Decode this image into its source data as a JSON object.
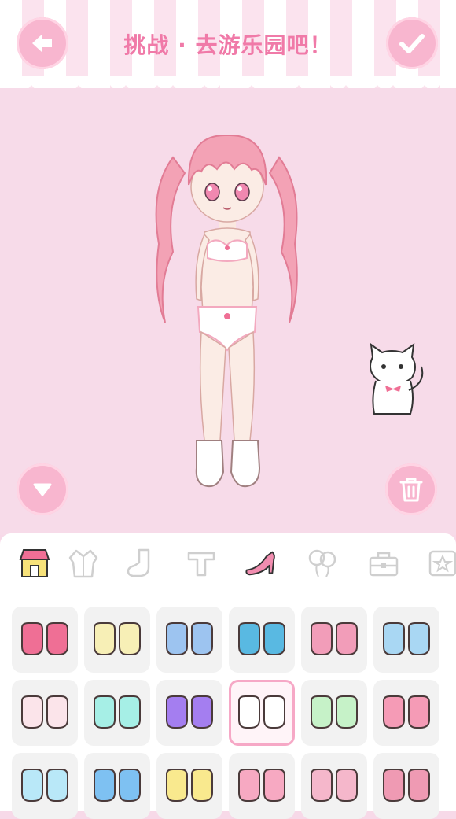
{
  "header": {
    "title": "挑战 · 去游乐园吧！",
    "back_icon": "arrow-left-icon",
    "confirm_icon": "checkmark-icon"
  },
  "stage": {
    "collapse_icon": "triangle-down-icon",
    "delete_icon": "trash-icon",
    "character": "pink-haired-girl-in-underwear",
    "pet": "white-cat-with-pink-bow"
  },
  "colors": {
    "accent": "#f07aa8",
    "button": "#f8b6cf",
    "background": "#f7d9e8",
    "tile": "#f2f2f2",
    "selected_border": "#f6a8c6"
  },
  "categories": [
    {
      "name": "shop",
      "icon": "shop-icon",
      "active": false
    },
    {
      "name": "coat",
      "icon": "coat-icon",
      "active": false
    },
    {
      "name": "socks",
      "icon": "sock-icon",
      "active": false
    },
    {
      "name": "tops",
      "icon": "tshirt-icon",
      "active": false
    },
    {
      "name": "shoes",
      "icon": "high-heel-icon",
      "active": true
    },
    {
      "name": "accessories",
      "icon": "balloon-icon",
      "active": false
    },
    {
      "name": "bags",
      "icon": "bag-icon",
      "active": false
    },
    {
      "name": "favorites",
      "icon": "star-icon",
      "active": false
    }
  ],
  "items": [
    {
      "icon": "pink-mary-jane-shoes-icon",
      "color": "#ef6f95"
    },
    {
      "icon": "cream-strap-shoes-icon",
      "color": "#f7efb6"
    },
    {
      "icon": "blue-yellow-buckle-shoes-icon",
      "color": "#9dc4f0"
    },
    {
      "icon": "blue-sneakers-icon",
      "color": "#59b9e2"
    },
    {
      "icon": "pink-buckle-shoes-icon",
      "color": "#f29db9"
    },
    {
      "icon": "blue-sandals-icon",
      "color": "#a9d7f3"
    },
    {
      "icon": "bear-slippers-icon",
      "color": "#fbe4ea"
    },
    {
      "icon": "bunny-slippers-icon",
      "color": "#a6efe6"
    },
    {
      "icon": "purple-flats-icon",
      "color": "#a47ef0"
    },
    {
      "icon": "white-socks-icon",
      "color": "#ffffff",
      "selected": true
    },
    {
      "icon": "bunny-ear-shoes-icon",
      "color": "#c6f2c8"
    },
    {
      "icon": "pink-bow-shoes-icon",
      "color": "#f59bb6"
    },
    {
      "icon": "blue-ankle-boots-icon",
      "color": "#b9e8f8"
    },
    {
      "icon": "blue-bow-boots-icon",
      "color": "#7ec1f2"
    },
    {
      "icon": "yellow-bow-shoes-icon",
      "color": "#f9e98e"
    },
    {
      "icon": "pink-frill-boots-icon",
      "color": "#f7a9c2"
    },
    {
      "icon": "pink-bow-boots-icon",
      "color": "#f5b7cb"
    },
    {
      "icon": "pink-lace-boots-icon",
      "color": "#ef9ab3"
    }
  ]
}
